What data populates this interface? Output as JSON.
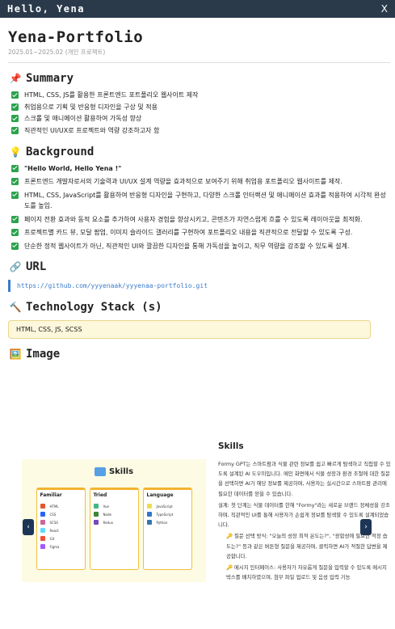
{
  "window": {
    "title": "Hello, Yena",
    "close": "X"
  },
  "project": {
    "title": "Yena-Portfolio",
    "period": "2025.01~2025.02 (개인 프로젝트)"
  },
  "summary": {
    "heading": "Summary",
    "icon": "pushpin-icon",
    "items": [
      "HTML, CSS, JS를 활용한 프론트엔드 포트폴리오 웹사이트 제작",
      "취업용으로 기획 및 반응형 디자인을 구상 및 적용",
      "스크롤 및 애니메이션 활용하여 가독성 향상",
      "직관적인 UI/UX로 프로젝트와 역량 강조하고자 함"
    ]
  },
  "background": {
    "heading": "Background",
    "icon": "lightbulb-icon",
    "items": [
      "\"Hello World, Hello Yena !\"",
      "프론트엔드 개발자로서의 기술력과 UI/UX 설계 역량을 효과적으로 보여주기 위해 취업용 포트폴리오 웹사이트를 제작.",
      "HTML, CSS, JavaScript를 활용하여 반응형 디자인을 구현하고, 다양한 스크롤 인터랙션 및 애니메이션 효과를 적용하여 시각적 완성도를 높임.",
      "페이지 전환 효과와 동적 요소를 추가하여 사용자 경험을 향상시키고, 콘텐츠가 자연스럽게 흐를 수 있도록 레이아웃을 최적화.",
      "프로젝트별 카드 뷰, 모달 팝업, 이미지 슬라이드 갤러리를 구현하여 포트폴리오 내용을 직관적으로 전달할 수 있도록 구성.",
      "단순한 정적 웹사이트가 아닌, 직관적인 UI와 깔끔한 디자인을 통해 가독성을 높이고, 직무 역량을 강조할 수 있도록 설계."
    ]
  },
  "url": {
    "heading": "URL",
    "icon": "link-icon",
    "link": "https://github.com/yyyenaak/yyyenaa-portfolio.git"
  },
  "tech": {
    "heading": "Technology Stack (s)",
    "icon": "hammer-icon",
    "value": "HTML, CSS, JS, SCSS"
  },
  "image": {
    "heading": "Image",
    "icon": "picture-icon",
    "preview": {
      "title": "Skills",
      "columns": [
        {
          "title": "Familiar",
          "items": [
            "HTML",
            "CSS",
            "SCSS",
            "React",
            "Git",
            "Figma"
          ]
        },
        {
          "title": "Tried",
          "items": [
            "Vue",
            "Node",
            "Redux"
          ]
        },
        {
          "title": "Language",
          "items": [
            "JavaScript",
            "TypeScript",
            "Python"
          ]
        }
      ],
      "prev": "‹",
      "next": "›"
    },
    "side": {
      "title": "Skills",
      "paragraphs": [
        "Formy GPT는 스마트팜과 식물 관련 정보를 쉽고 빠르게 탐색하고 직접할 수 있도록 설계된 AI 도우미입니다. 메인 화면에서 식물 성장과 환경 조절에 대한 질문을 선택하면 AI가 해당 정보를 제공하며, 사용자는 실시간으로 스마트팜 관리에 필요한 데이터를 얻을 수 있습니다.",
        "설계: 첫 단계는 식물 데이터를 한해 \"Formy\"라는 새로운 브랜드 정체성을 강조하며, 직관적인 UI를 통해 사용자가 손쉽게 정보를 탐색할 수 있도록 설계되었습니다."
      ],
      "tips": [
        "질문 선택 방식: \"오늘의 성장 최적 온도는?\", \"광합성에 필요한 적정 습도는?\" 등과 같은 버튼형 질문을 제공하며, 클릭하면 AI가 적절한 답변을 제공합니다.",
        "메시지 인터페이스: 사용자가 자유롭게 질문을 입력할 수 있도록 메시지 박스를 배치하였으며, 첨부 파일 업로드 및 음성 입력 기능"
      ]
    }
  }
}
